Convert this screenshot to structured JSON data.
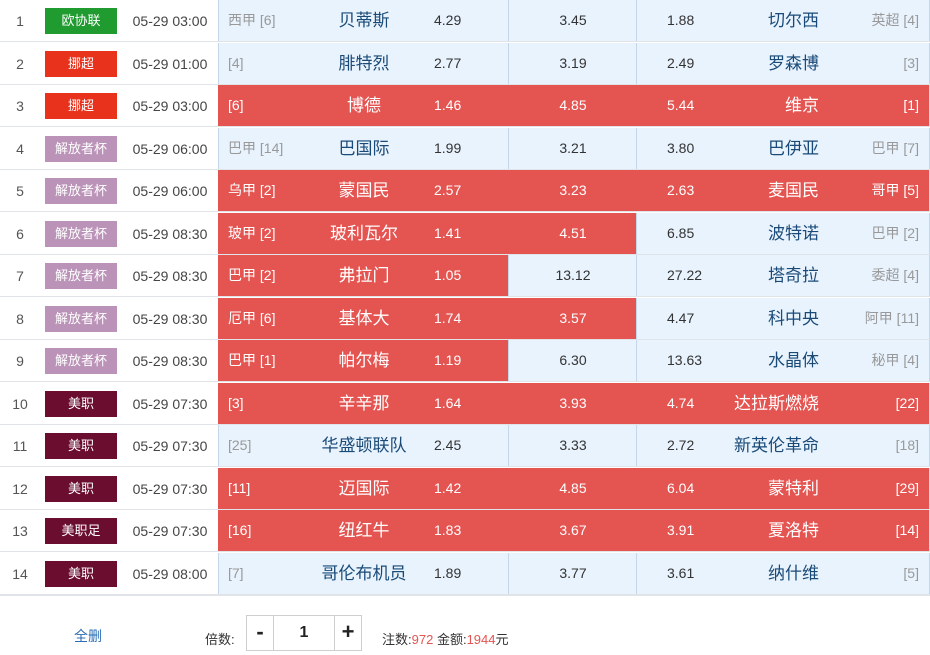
{
  "colors": {
    "hot_red": "#e45451",
    "cool_blue": "#e8f3fd",
    "link_blue": "#2a6db5",
    "league": {
      "欧协联": "#1f9b2f",
      "挪超": "#e8321c",
      "解放者杯": "#bb93b8",
      "美职": "#6a0d2f",
      "美职足": "#6a0d2f"
    }
  },
  "rows": [
    {
      "idx": "1",
      "league": "欧协联",
      "time": "05-29 03:00",
      "home_rank": "西甲 [6]",
      "home": "贝蒂斯",
      "h": "4.29",
      "d": "3.45",
      "a": "1.88",
      "away": "切尔西",
      "away_rank": "英超 [4]",
      "sel": [
        false,
        false,
        false
      ]
    },
    {
      "idx": "2",
      "league": "挪超",
      "time": "05-29 01:00",
      "home_rank": "[4]",
      "home": "腓特烈",
      "h": "2.77",
      "d": "3.19",
      "a": "2.49",
      "away": "罗森博",
      "away_rank": "[3]",
      "sel": [
        false,
        false,
        false
      ]
    },
    {
      "idx": "3",
      "league": "挪超",
      "time": "05-29 03:00",
      "home_rank": "[6]",
      "home": "博德",
      "h": "1.46",
      "d": "4.85",
      "a": "5.44",
      "away": "维京",
      "away_rank": "[1]",
      "sel": [
        true,
        true,
        true
      ]
    },
    {
      "idx": "4",
      "league": "解放者杯",
      "time": "05-29 06:00",
      "home_rank": "巴甲 [14]",
      "home": "巴国际",
      "h": "1.99",
      "d": "3.21",
      "a": "3.80",
      "away": "巴伊亚",
      "away_rank": "巴甲 [7]",
      "sel": [
        false,
        false,
        false
      ]
    },
    {
      "idx": "5",
      "league": "解放者杯",
      "time": "05-29 06:00",
      "home_rank": "乌甲 [2]",
      "home": "蒙国民",
      "h": "2.57",
      "d": "3.23",
      "a": "2.63",
      "away": "麦国民",
      "away_rank": "哥甲 [5]",
      "sel": [
        true,
        true,
        true
      ]
    },
    {
      "idx": "6",
      "league": "解放者杯",
      "time": "05-29 08:30",
      "home_rank": "玻甲 [2]",
      "home": "玻利瓦尔",
      "h": "1.41",
      "d": "4.51",
      "a": "6.85",
      "away": "波特诺",
      "away_rank": "巴甲 [2]",
      "sel": [
        true,
        true,
        false
      ]
    },
    {
      "idx": "7",
      "league": "解放者杯",
      "time": "05-29 08:30",
      "home_rank": "巴甲 [2]",
      "home": "弗拉门",
      "h": "1.05",
      "d": "13.12",
      "a": "27.22",
      "away": "塔奇拉",
      "away_rank": "委超 [4]",
      "sel": [
        true,
        false,
        false
      ]
    },
    {
      "idx": "8",
      "league": "解放者杯",
      "time": "05-29 08:30",
      "home_rank": "厄甲 [6]",
      "home": "基体大",
      "h": "1.74",
      "d": "3.57",
      "a": "4.47",
      "away": "科中央",
      "away_rank": "阿甲 [11]",
      "sel": [
        true,
        true,
        false
      ]
    },
    {
      "idx": "9",
      "league": "解放者杯",
      "time": "05-29 08:30",
      "home_rank": "巴甲 [1]",
      "home": "帕尔梅",
      "h": "1.19",
      "d": "6.30",
      "a": "13.63",
      "away": "水晶体",
      "away_rank": "秘甲 [4]",
      "sel": [
        true,
        false,
        false
      ]
    },
    {
      "idx": "10",
      "league": "美职",
      "time": "05-29 07:30",
      "home_rank": "[3]",
      "home": "辛辛那",
      "h": "1.64",
      "d": "3.93",
      "a": "4.74",
      "away": "达拉斯燃烧",
      "away_rank": "[22]",
      "sel": [
        true,
        true,
        true
      ]
    },
    {
      "idx": "11",
      "league": "美职",
      "time": "05-29 07:30",
      "home_rank": "[25]",
      "home": "华盛顿联队",
      "h": "2.45",
      "d": "3.33",
      "a": "2.72",
      "away": "新英伦革命",
      "away_rank": "[18]",
      "sel": [
        false,
        false,
        false
      ]
    },
    {
      "idx": "12",
      "league": "美职",
      "time": "05-29 07:30",
      "home_rank": "[11]",
      "home": "迈国际",
      "h": "1.42",
      "d": "4.85",
      "a": "6.04",
      "away": "蒙特利",
      "away_rank": "[29]",
      "sel": [
        true,
        true,
        true
      ]
    },
    {
      "idx": "13",
      "league": "美职足",
      "time": "05-29 07:30",
      "home_rank": "[16]",
      "home": "纽红牛",
      "h": "1.83",
      "d": "3.67",
      "a": "3.91",
      "away": "夏洛特",
      "away_rank": "[14]",
      "sel": [
        true,
        true,
        true
      ]
    },
    {
      "idx": "14",
      "league": "美职",
      "time": "05-29 08:00",
      "home_rank": "[7]",
      "home": "哥伦布机员",
      "h": "1.89",
      "d": "3.77",
      "a": "3.61",
      "away": "纳什维",
      "away_rank": "[5]",
      "sel": [
        false,
        false,
        false
      ]
    }
  ],
  "footer": {
    "clear_label": "全删",
    "multiplier_label": "倍数:",
    "minus": "-",
    "plus": "+",
    "multiplier_value": "1",
    "bets_label": "注数:",
    "bets_value": "972",
    "amount_label": "金额:",
    "amount_value": "1944",
    "amount_unit": "元"
  }
}
